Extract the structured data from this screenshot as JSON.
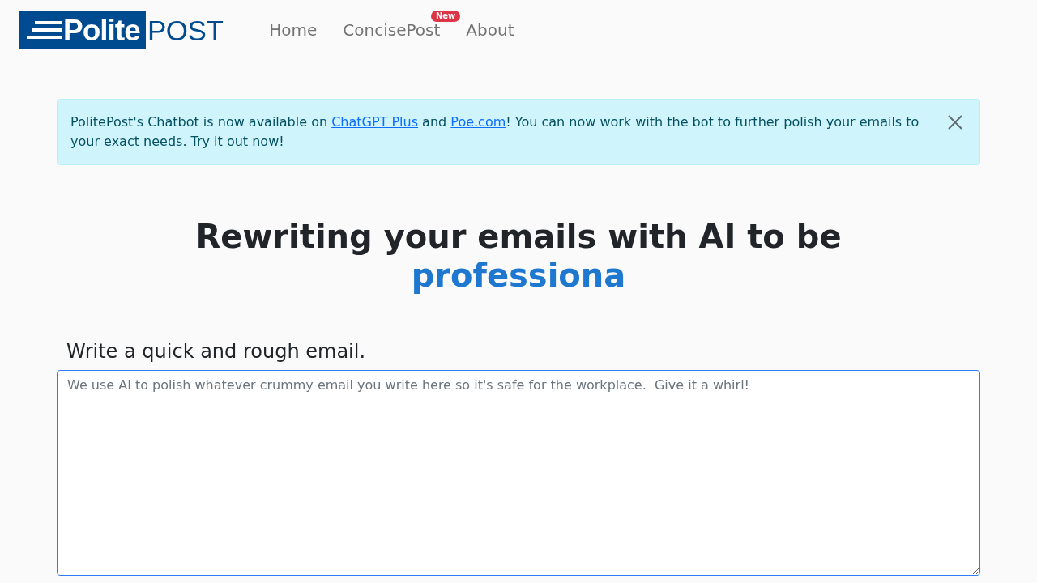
{
  "navbar": {
    "logo": {
      "badge_text": "Polite",
      "text": "POST"
    },
    "links": [
      {
        "label": "Home"
      },
      {
        "label": "ConcisePost",
        "badge": "New"
      },
      {
        "label": "About"
      }
    ]
  },
  "alert": {
    "parts": [
      {
        "kind": "text",
        "text": "PolitePost's Chatbot is now available on "
      },
      {
        "kind": "link",
        "text": "ChatGPT Plus"
      },
      {
        "kind": "text",
        "text": " and "
      },
      {
        "kind": "link",
        "text": "Poe.com"
      },
      {
        "kind": "text",
        "text": "! You can now work with the bot to further polish your emails to your exact needs. Try it out now!"
      }
    ],
    "dismissible": true
  },
  "hero": {
    "title": "Rewriting your emails with AI to be",
    "highlight": "professiona"
  },
  "email_form": {
    "label": "Write a quick and rough email.",
    "placeholder": "We use AI to polish whatever crummy email you write here so it's safe for the workplace.  Give it a whirl!",
    "focused": true
  }
}
